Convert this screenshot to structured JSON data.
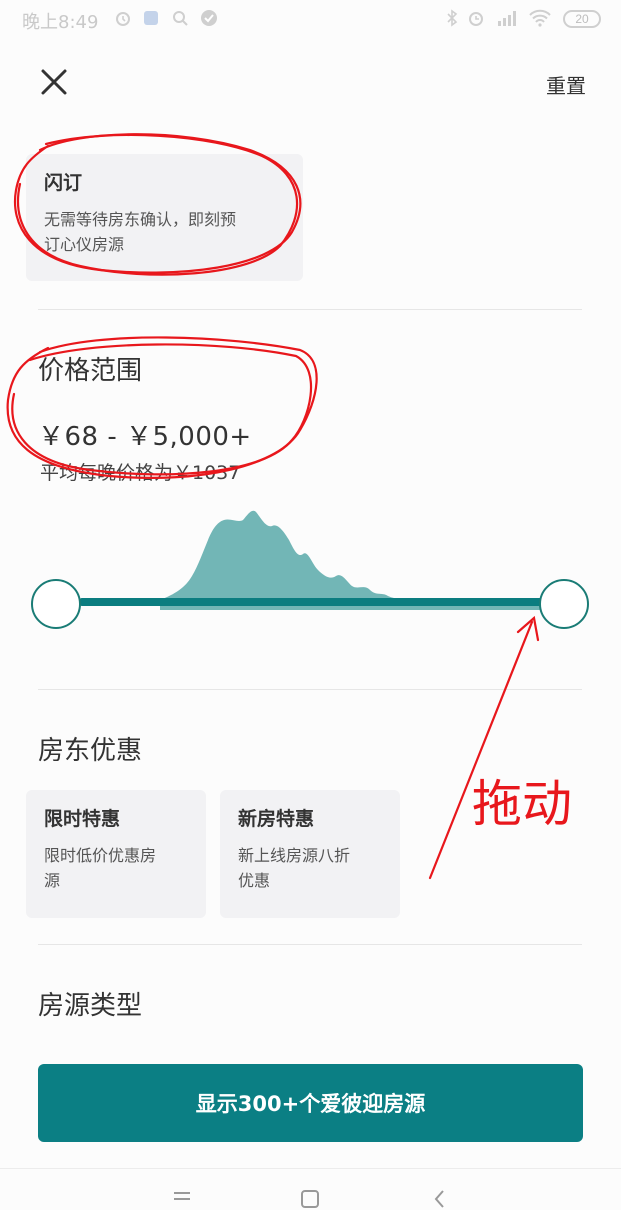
{
  "status_bar": {
    "time": "晚上8:49",
    "battery": "20"
  },
  "header": {
    "reset_label": "重置"
  },
  "flash_booking": {
    "title": "闪订",
    "desc_line1": "无需等待房东确认，即刻预",
    "desc_line2": "订心仪房源"
  },
  "price": {
    "section_title": "价格范围",
    "range": "￥68 - ￥5,000+",
    "average": "平均每晚价格为￥1037",
    "slider_min_fraction": 0,
    "slider_max_fraction": 1
  },
  "host_deals": {
    "section_title": "房东优惠",
    "cards": [
      {
        "title": "限时特惠",
        "desc_line1": "限时低价优惠房",
        "desc_line2": "源"
      },
      {
        "title": "新房特惠",
        "desc_line1": "新上线房源八折",
        "desc_line2": "优惠"
      }
    ]
  },
  "property_type": {
    "section_title": "房源类型"
  },
  "annotation": {
    "drag_label": "拖动",
    "color": "#e8171c"
  },
  "cta": {
    "label": "显示300+个爱彼迎房源"
  },
  "colors": {
    "accent": "#0b7f84",
    "histogram_fill": "#72b6b6"
  }
}
